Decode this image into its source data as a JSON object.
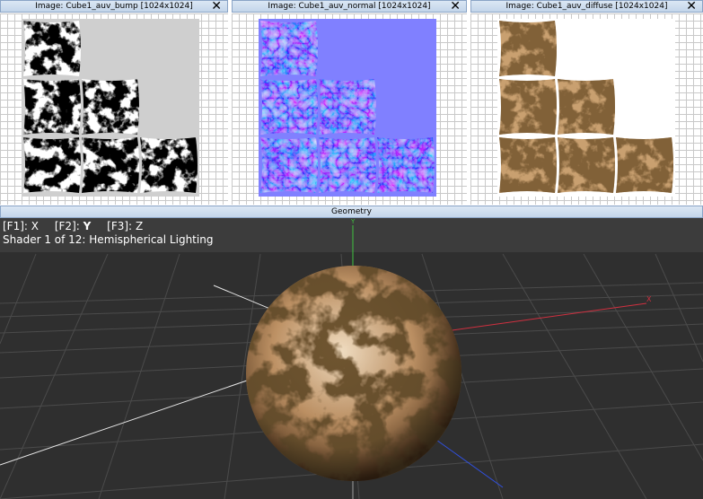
{
  "panels": [
    {
      "title": "Image: Cube1_auv_bump [1024x1024]",
      "background": "#cfcfcf"
    },
    {
      "title": "Image: Cube1_auv_normal [1024x1024]",
      "background": "#8080ff"
    },
    {
      "title": "Image: Cube1_auv_diffuse [1024x1024]",
      "background": "#ffffff"
    }
  ],
  "close_glyph": "✕",
  "geometry": {
    "title": "Geometry",
    "keys": [
      {
        "key": "[F1]:",
        "axis": "X"
      },
      {
        "key": "[F2]:",
        "axis": "Y"
      },
      {
        "key": "[F3]:",
        "axis": "Z"
      }
    ],
    "shader_status": "Shader 1 of 12: Hemispherical Lighting",
    "axis_labels": {
      "x": "X",
      "y": "Y"
    }
  },
  "colors": {
    "title_bar": "#c9d9ec",
    "viewport_bg": "#2f2f2f",
    "grid": "#4a4a4a",
    "axis_x": "#d03040",
    "axis_y": "#40c040",
    "axis_z": "#3050e0"
  }
}
